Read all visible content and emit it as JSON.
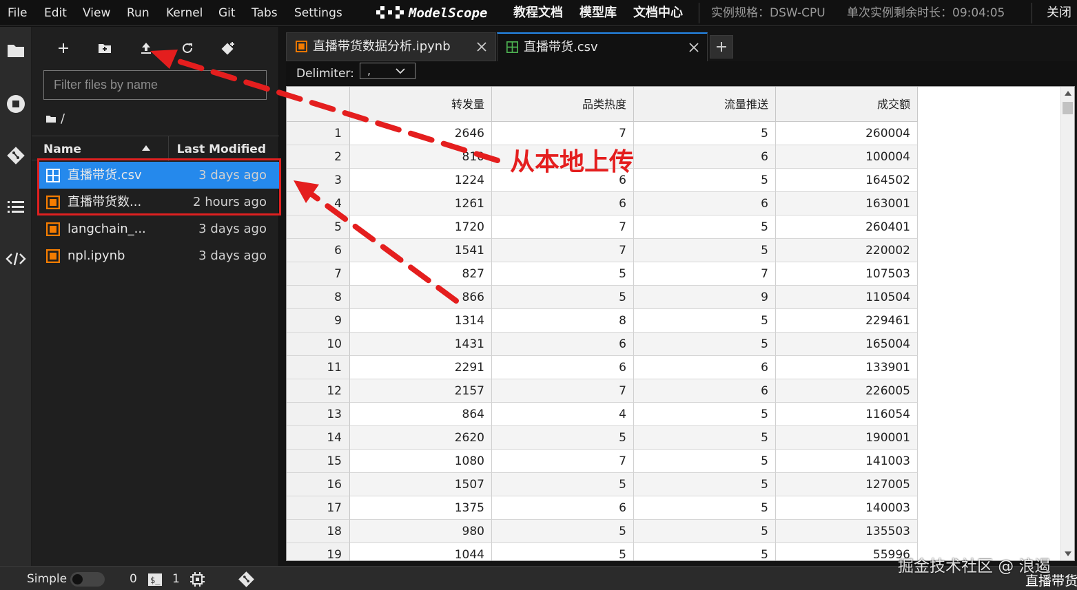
{
  "menubar": {
    "items": [
      "File",
      "Edit",
      "View",
      "Run",
      "Kernel",
      "Git",
      "Tabs",
      "Settings"
    ],
    "logo_text": "ModelScope",
    "links": [
      "教程文档",
      "模型库",
      "文档中心"
    ],
    "instance_spec": "实例规格：DSW-CPU",
    "remaining_time": "单次实例剩余时长：09:04:05",
    "close_label": "关闭"
  },
  "filebrowser": {
    "filter_placeholder": "Filter files by name",
    "breadcrumb": "/",
    "col_name": "Name",
    "col_modified": "Last Modified",
    "files": [
      {
        "name": "直播带货.csv",
        "modified": "3 days ago",
        "type": "csv",
        "selected": true
      },
      {
        "name": "直播带货数...",
        "modified": "2 hours ago",
        "type": "notebook",
        "selected": false
      },
      {
        "name": "langchain_...",
        "modified": "3 days ago",
        "type": "notebook",
        "selected": false
      },
      {
        "name": "npl.ipynb",
        "modified": "3 days ago",
        "type": "notebook",
        "selected": false
      }
    ]
  },
  "tabs": [
    {
      "label": "直播带货数据分析.ipynb",
      "type": "notebook",
      "active": false
    },
    {
      "label": "直播带货.csv",
      "type": "csv",
      "active": true
    }
  ],
  "csv": {
    "delimiter_label": "Delimiter:",
    "delimiter_value": ",",
    "columns": [
      "转发量",
      "品类热度",
      "流量推送",
      "成交额"
    ],
    "rows": [
      [
        "1",
        "2646",
        "7",
        "5",
        "260004"
      ],
      [
        "2",
        "810",
        "",
        "6",
        "100004"
      ],
      [
        "3",
        "1224",
        "6",
        "5",
        "164502"
      ],
      [
        "4",
        "1261",
        "6",
        "6",
        "163001"
      ],
      [
        "5",
        "1720",
        "7",
        "5",
        "260401"
      ],
      [
        "6",
        "1541",
        "7",
        "5",
        "220002"
      ],
      [
        "7",
        "827",
        "5",
        "7",
        "107503"
      ],
      [
        "8",
        "866",
        "5",
        "9",
        "110504"
      ],
      [
        "9",
        "1314",
        "8",
        "5",
        "229461"
      ],
      [
        "10",
        "1431",
        "6",
        "5",
        "165004"
      ],
      [
        "11",
        "2291",
        "6",
        "6",
        "133901"
      ],
      [
        "12",
        "2157",
        "7",
        "6",
        "226005"
      ],
      [
        "13",
        "864",
        "4",
        "5",
        "116054"
      ],
      [
        "14",
        "2620",
        "5",
        "5",
        "190001"
      ],
      [
        "15",
        "1080",
        "7",
        "5",
        "141003"
      ],
      [
        "16",
        "1507",
        "5",
        "5",
        "127005"
      ],
      [
        "17",
        "1375",
        "6",
        "5",
        "140003"
      ],
      [
        "18",
        "980",
        "5",
        "5",
        "135503"
      ],
      [
        "19",
        "1044",
        "5",
        "5",
        "55996"
      ]
    ]
  },
  "statusbar": {
    "mode": "Simple",
    "terminals": "0",
    "kernels": "1"
  },
  "annotation": {
    "text": "从本地上传",
    "color": "#e41e1e"
  },
  "watermark": {
    "text": "掘金技术社区 @ 浪遏",
    "sub": "直播带货"
  },
  "colors": {
    "accent": "#2589ec",
    "notebook_icon": "#f57c00",
    "csv_icon": "#4caf50"
  }
}
